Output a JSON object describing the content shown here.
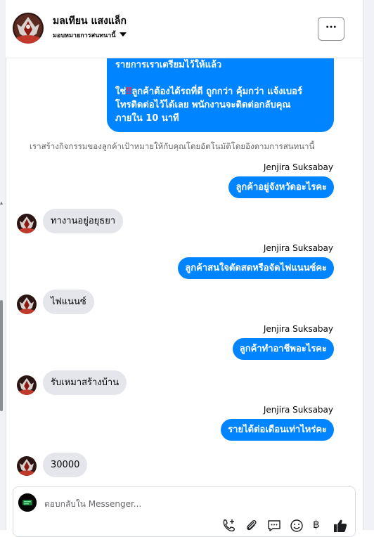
{
  "contact": {
    "name": "มลเทียน แสงแล็ก",
    "subtitle": "มอบหมายการสนทนานี้",
    "more_label": "···"
  },
  "messages": {
    "first_bubble": {
      "line1": "รายการเราเตรียมไว้ให้แล้ว",
      "line2_prefix": "ใช่",
      "line2_emoji": "‼",
      "line2_rest": "ลูกค้าต้องได้รถที่ดี ถูกกว่า คุ้มกว่า แจ้งเบอร์",
      "line3": "โทรติดต่อไว้ได้เลย พนักงานจะติดต่อกลับคุณ",
      "line4": "ภายใน 10 นาที"
    },
    "system_note": "เราสร้างกิจกรรมของลูกค้าเป้าหมายให้กับคุณโดยอัตโนมัติโดยอิงตามการสนทนานี้",
    "sender_name": "Jenjira Suksabay",
    "q1": "ลูกค้าอยู่จังหวัดอะไรคะ",
    "a1": "ทางานอยู่อยุธยา",
    "q2": "ลูกค้าสนใจตัดสดหรือจัดไฟแนนซ์คะ",
    "a2": "ไฟแนนซ์",
    "q3": "ลูกค้าทำอาชีพอะไรคะ",
    "a3": "รับเหมาสร้างบ้าน",
    "q4": "รายได้ต่อเดือนเท่าไหร่คะ",
    "a4": "30000"
  },
  "composer": {
    "placeholder": "ตอบกลับใน Messenger...",
    "tools": [
      "phone-plus-icon",
      "paperclip-icon",
      "saved-reply-icon",
      "emoji-icon",
      "baht-icon",
      "like-icon"
    ],
    "baht_symbol": "฿"
  },
  "colors": {
    "outgoing_bubble": "#0084ff",
    "incoming_bubble": "#e4e6eb",
    "system_text": "#65676b"
  }
}
